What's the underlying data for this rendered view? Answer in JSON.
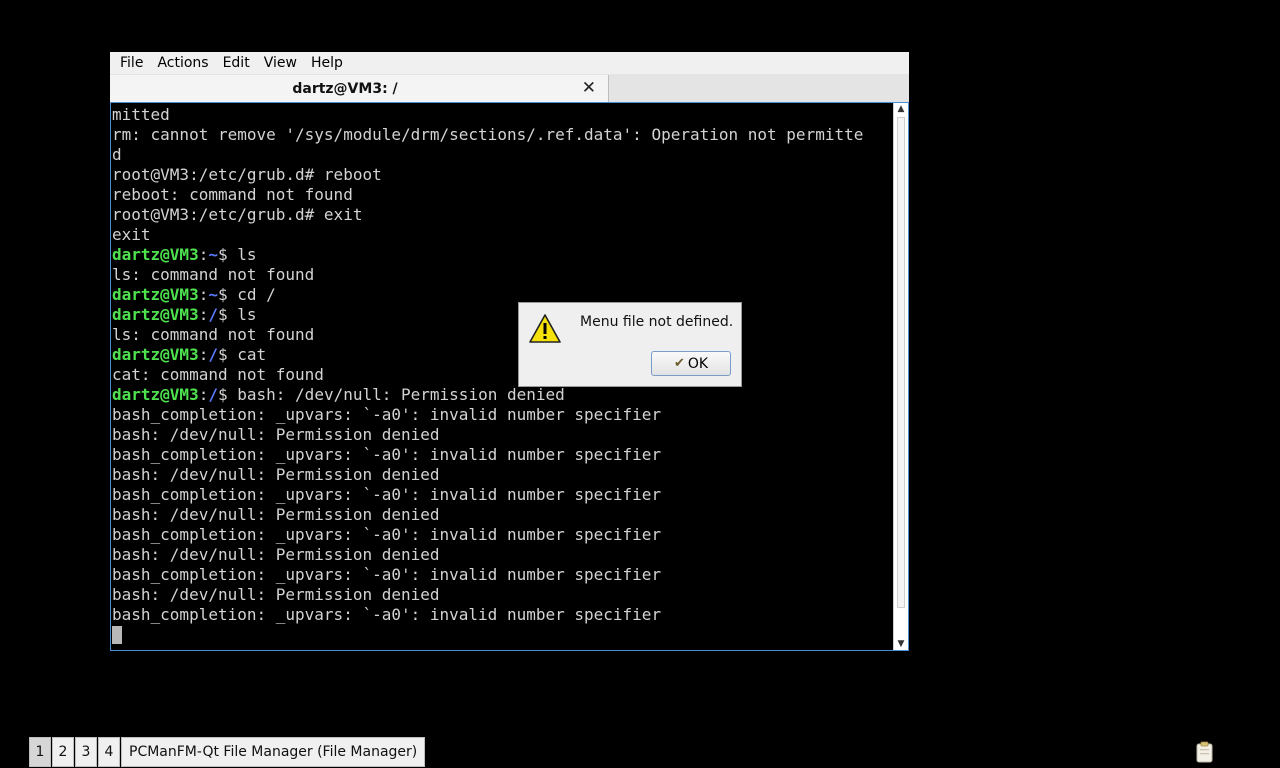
{
  "menubar": {
    "items": [
      "File",
      "Actions",
      "Edit",
      "View",
      "Help"
    ]
  },
  "tab": {
    "title": "dartz@VM3: /",
    "close_icon": "close-icon"
  },
  "terminal": {
    "plain_lines_1": [
      "mitted",
      "rm: cannot remove '/sys/module/drm/sections/.ref.data': Operation not permitte",
      "d",
      "root@VM3:/etc/grub.d# reboot",
      "reboot: command not found",
      "root@VM3:/etc/grub.d# exit",
      "exit"
    ],
    "user_host": "dartz@VM3",
    "colon": ":",
    "lines": [
      {
        "path": "~",
        "cmd": "$ ls"
      },
      {
        "text": "ls: command not found"
      },
      {
        "path": "~",
        "cmd": "$ cd /"
      },
      {
        "path": "/",
        "cmd": "$ ls"
      },
      {
        "text": "ls: command not found"
      },
      {
        "path": "/",
        "cmd": "$ cat"
      },
      {
        "text": "cat: command not found"
      },
      {
        "path": "/",
        "cmd": "$ bash: /dev/null: Permission denied"
      },
      {
        "text": "bash_completion: _upvars: `-a0': invalid number specifier"
      },
      {
        "text": "bash: /dev/null: Permission denied"
      },
      {
        "text": "bash_completion: _upvars: `-a0': invalid number specifier"
      },
      {
        "text": "bash: /dev/null: Permission denied"
      },
      {
        "text": "bash_completion: _upvars: `-a0': invalid number specifier"
      },
      {
        "text": "bash: /dev/null: Permission denied"
      },
      {
        "text": "bash_completion: _upvars: `-a0': invalid number specifier"
      },
      {
        "text": "bash: /dev/null: Permission denied"
      },
      {
        "text": "bash_completion: _upvars: `-a0': invalid number specifier"
      },
      {
        "text": "bash: /dev/null: Permission denied"
      },
      {
        "text": "bash_completion: _upvars: `-a0': invalid number specifier"
      }
    ],
    "colors": {
      "user": "#4ee24e",
      "path": "#5b7bff",
      "text": "#d3d3d3"
    }
  },
  "dialog": {
    "message": "Menu file not defined.",
    "ok_label": "OK",
    "icon": "warning-icon"
  },
  "taskbar": {
    "desktops": [
      "1",
      "2",
      "3",
      "4"
    ],
    "active_desktop": "1",
    "task": "PCManFM-Qt File Manager (File Manager)"
  },
  "tray": {
    "icon": "clipboard-icon"
  }
}
